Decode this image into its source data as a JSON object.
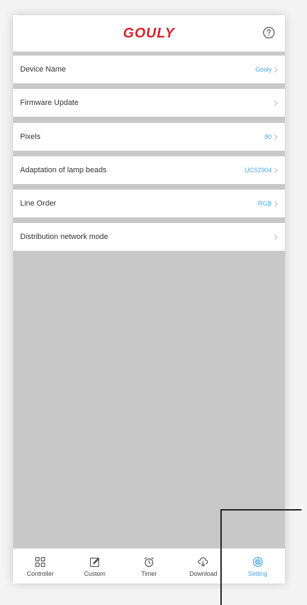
{
  "header": {
    "logo": "GOULY",
    "help_icon": "help-circle-icon"
  },
  "settings": [
    {
      "label": "Device Name",
      "value": "Gouly"
    },
    {
      "label": "Firmware Update",
      "value": ""
    },
    {
      "label": "Pixels",
      "value": "80"
    },
    {
      "label": "Adaptation of lamp beads",
      "value": "UCS2904"
    },
    {
      "label": "Line Order",
      "value": "RGB"
    },
    {
      "label": "Distribution network mode",
      "value": ""
    }
  ],
  "tabs": [
    {
      "label": "Controller",
      "icon": "grid-icon",
      "active": false
    },
    {
      "label": "Custom",
      "icon": "edit-icon",
      "active": false
    },
    {
      "label": "Timer",
      "icon": "alarm-clock-icon",
      "active": false
    },
    {
      "label": "Download",
      "icon": "cloud-download-icon",
      "active": false
    },
    {
      "label": "Setting",
      "icon": "settings-icon",
      "active": true
    }
  ],
  "colors": {
    "brand": "#d9232d",
    "accent": "#49a7e6",
    "content_background": "#c8c8c8"
  }
}
